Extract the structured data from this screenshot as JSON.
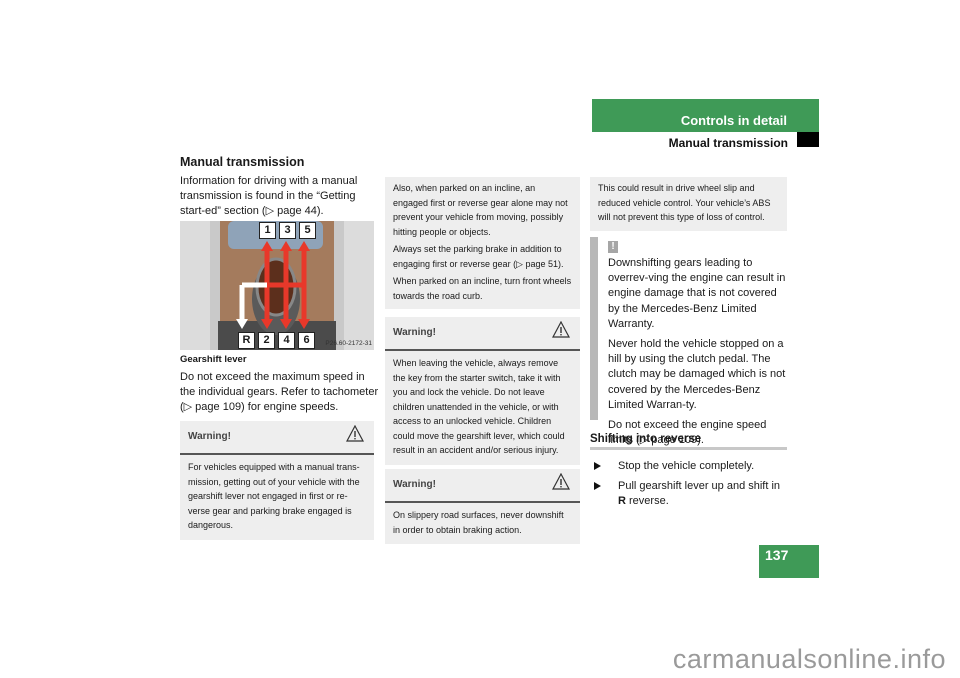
{
  "header": {
    "section": "Controls in detail",
    "subsection": "Manual transmission",
    "page_number": "137",
    "accent_color": "#3f9a57"
  },
  "col1": {
    "title": "Manual transmission",
    "intro": "Information for driving with a manual transmission is found in the “Getting start-ed” section (▷ page 44).",
    "figure": {
      "gears_top": [
        "1",
        "3",
        "5"
      ],
      "gears_bottom": [
        "R",
        "2",
        "4",
        "6"
      ],
      "code": "P26.60-2172-31",
      "caption": "Gearshift lever"
    },
    "speed_note": "Do not exceed the maximum speed in the individual gears. Refer to tachometer (▷ page 109) for engine speeds.",
    "warning": {
      "title": "Warning!",
      "icon": "warning-triangle-icon",
      "body": "For vehicles equipped with a manual trans-mission, getting out of your vehicle with the gearshift lever not engaged in first or re-verse gear and parking brake engaged is dangerous."
    }
  },
  "col2": {
    "continued": [
      "Also, when parked on an incline, an engaged first or reverse gear alone may not prevent your vehicle from moving, possibly hitting people or objects.",
      "Always set the parking brake in addition to engaging first or reverse gear (▷ page 51).",
      "When parked on an incline, turn front wheels towards the road curb."
    ],
    "warning2": {
      "title": "Warning!",
      "icon": "warning-triangle-icon",
      "body": "When leaving the vehicle, always remove the key from the starter switch, take it with you and lock the vehicle. Do not leave children unattended in the vehicle, or with access to an unlocked vehicle. Children could move the gearshift lever, which could result in an accident and/or serious injury."
    },
    "warning3": {
      "title": "Warning!",
      "icon": "warning-triangle-icon",
      "body": "On slippery road surfaces, never downshift in order to obtain braking action."
    }
  },
  "col3": {
    "continued": "This could result in drive wheel slip and reduced vehicle control. Your vehicle’s ABS will not prevent this type of loss of control.",
    "note": {
      "icon": "!",
      "paragraphs": [
        "Downshifting gears leading to overrev-ving the engine can result in engine damage that is not covered by the Mercedes-Benz Limited Warranty.",
        "Never hold the vehicle stopped on a hill by using the clutch pedal. The clutch may be damaged which is not covered by the Mercedes-Benz Limited Warran-ty.",
        "Do not exceed the engine speed limits (▷ page 109)."
      ]
    },
    "reverse_title": "Shifting into reverse",
    "steps": [
      {
        "text": "Stop the vehicle completely."
      },
      {
        "text_before": "Pull gearshift lever up and shift in ",
        "bold": "R",
        "text_after": " reverse."
      }
    ]
  },
  "watermark": "carmanualsonline.info"
}
